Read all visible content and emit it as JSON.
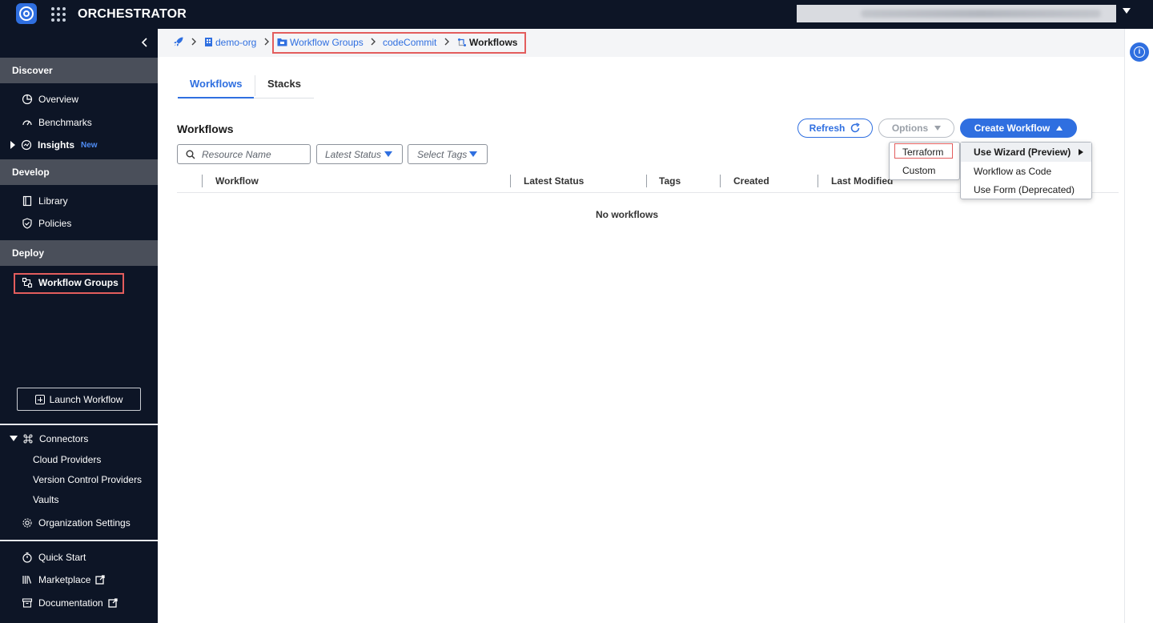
{
  "topbar": {
    "app_title": "ORCHESTRATOR"
  },
  "sidebar": {
    "sections": {
      "discover": "Discover",
      "develop": "Develop",
      "deploy": "Deploy"
    },
    "items": {
      "overview": "Overview",
      "benchmarks": "Benchmarks",
      "insights": "Insights",
      "insights_badge": "New",
      "library": "Library",
      "policies": "Policies",
      "workflow_groups": "Workflow Groups"
    },
    "launch_workflow": "Launch Workflow",
    "connectors": "Connectors",
    "connector_items": [
      "Cloud Providers",
      "Version Control Providers",
      "Vaults"
    ],
    "organization_settings": "Organization Settings",
    "quick_start": "Quick Start",
    "marketplace": "Marketplace",
    "documentation": "Documentation"
  },
  "breadcrumb": {
    "org": "demo-org",
    "workflow_groups": "Workflow Groups",
    "group": "codeCommit",
    "current": "Workflows"
  },
  "tabs": {
    "workflows": "Workflows",
    "stacks": "Stacks"
  },
  "main": {
    "title": "Workflows",
    "refresh": "Refresh",
    "options": "Options",
    "create_workflow": "Create Workflow",
    "search_placeholder": "Resource Name",
    "latest_status_filter": "Latest Status",
    "select_tags_filter": "Select Tags",
    "columns": [
      "Workflow",
      "Latest Status",
      "Tags",
      "Created",
      "Last Modified"
    ],
    "empty_message": "No workflows"
  },
  "menus": {
    "type_menu": [
      "Terraform",
      "Custom"
    ],
    "create_menu": [
      "Use Wizard (Preview)",
      "Workflow as Code",
      "Use Form (Deprecated)"
    ]
  },
  "colors": {
    "accent": "#2f6fe0",
    "sidebar_bg": "#0d1526",
    "section_bg": "#4a4f5a",
    "highlight": "#e35d5d"
  }
}
